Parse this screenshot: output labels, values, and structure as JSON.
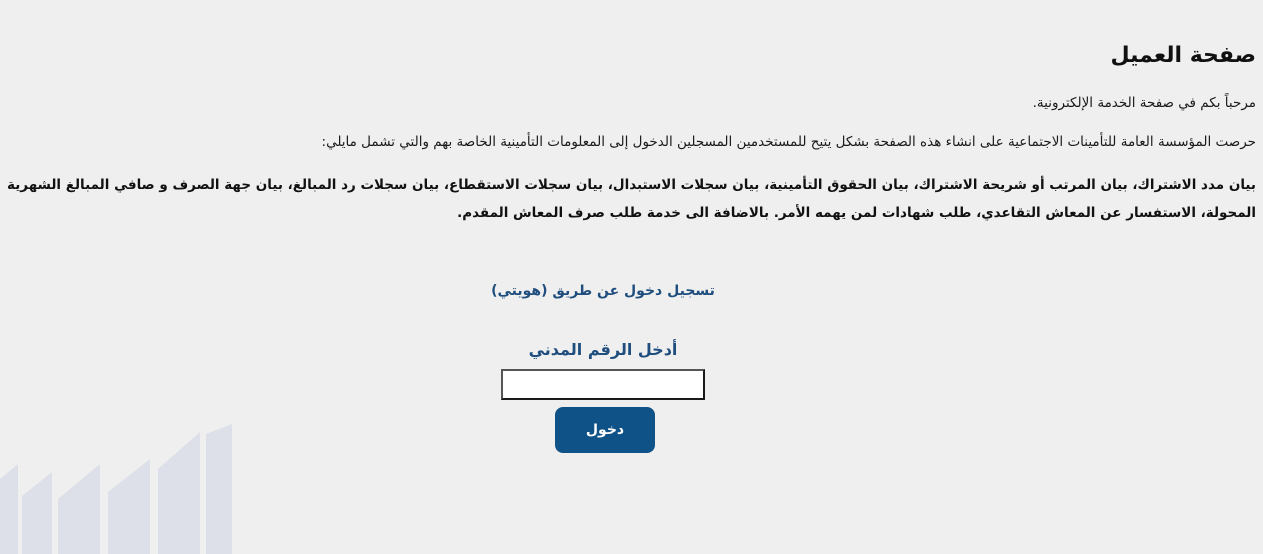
{
  "page": {
    "title": "صفحة العميل",
    "welcome": "مرحباً بكم في صفحة الخدمة الإلكترونية.",
    "intro": "حرصت المؤسسة العامة للتأمينات الاجتماعية على انشاء هذه الصفحة بشكل يتيح للمستخدمين المسجلين الدخول إلى المعلومات التأمينية الخاصة بهم والتي تشمل مايلي:",
    "services": "بيان مدد الاشتراك، بيان المرتب أو شريحة الاشتراك، بيان الحقوق التأمينية، بيان سجلات الاستبدال، بيان سجلات الاستقطاع، بيان سجلات رد المبالغ، بيان جهة الصرف و صافي المبالغ الشهرية المحولة، الاستفسار عن المعاش التقاعدي، طلب شهادات لمن يهمه الأمر. بالاضافة الى خدمة طلب صرف المعاش المقدم."
  },
  "login": {
    "link_label": "تسجيل دخول عن طريق (هويتي)",
    "civil_id_label": "أدخل الرقم المدني",
    "civil_id_value": "",
    "submit_label": "دخول"
  },
  "colors": {
    "background": "#efefef",
    "accent": "#1f4e7e",
    "button": "#0f5288",
    "watermark": "#dfe2ea"
  }
}
